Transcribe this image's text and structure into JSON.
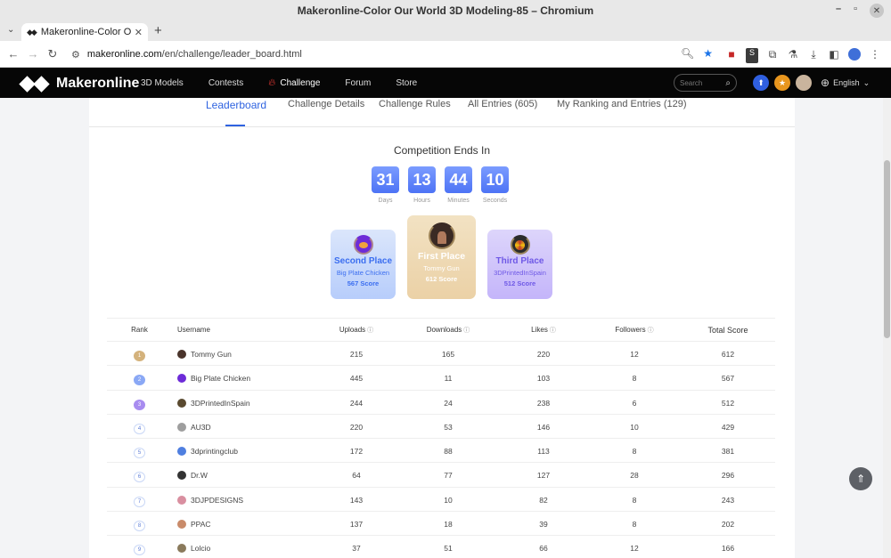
{
  "window": {
    "title": "Makeronline-Color Our World 3D Modeling-85 – Chromium"
  },
  "browser": {
    "tab_title": "Makeronline-Color Our W",
    "url_host": "makeronline.com",
    "url_path": "/en/challenge/leader_board.html"
  },
  "site": {
    "logo_text": "Makeronline",
    "nav": [
      "3D Models",
      "Contests",
      "Challenge",
      "Forum",
      "Store"
    ],
    "search_placeholder": "Search",
    "language": "English"
  },
  "subtabs": [
    "Leaderboard",
    "Challenge Details",
    "Challenge Rules",
    "All Entries (605)",
    "My Ranking and Entries (129)"
  ],
  "countdown": {
    "title": "Competition Ends In",
    "units": [
      {
        "value": "31",
        "label": "Days"
      },
      {
        "value": "13",
        "label": "Hours"
      },
      {
        "value": "44",
        "label": "Minutes"
      },
      {
        "value": "10",
        "label": "Seconds"
      }
    ]
  },
  "podium": {
    "second": {
      "place": "Second Place",
      "name": "Big Plate Chicken",
      "score": "567 Score"
    },
    "first": {
      "place": "First Place",
      "name": "Tommy Gun",
      "score": "612 Score"
    },
    "third": {
      "place": "Third Place",
      "name": "3DPrintedInSpain",
      "score": "512 Score"
    }
  },
  "table": {
    "headers": {
      "rank": "Rank",
      "username": "Username",
      "uploads": "Uploads",
      "downloads": "Downloads",
      "likes": "Likes",
      "followers": "Followers",
      "total": "Total Score"
    },
    "rows": [
      {
        "rank": "1",
        "user": "Tommy Gun",
        "uploads": "215",
        "downloads": "165",
        "likes": "220",
        "followers": "12",
        "total": "612",
        "avatar_color": "#4a342b"
      },
      {
        "rank": "2",
        "user": "Big Plate Chicken",
        "uploads": "445",
        "downloads": "11",
        "likes": "103",
        "followers": "8",
        "total": "567",
        "avatar_color": "#6d2bd8"
      },
      {
        "rank": "3",
        "user": "3DPrintedInSpain",
        "uploads": "244",
        "downloads": "24",
        "likes": "238",
        "followers": "6",
        "total": "512",
        "avatar_color": "#5a4a30"
      },
      {
        "rank": "4",
        "user": "AU3D",
        "uploads": "220",
        "downloads": "53",
        "likes": "146",
        "followers": "10",
        "total": "429",
        "avatar_color": "#9e9e9e"
      },
      {
        "rank": "5",
        "user": "3dprintingclub",
        "uploads": "172",
        "downloads": "88",
        "likes": "113",
        "followers": "8",
        "total": "381",
        "avatar_color": "#4f7fe0"
      },
      {
        "rank": "6",
        "user": "Dr.W",
        "uploads": "64",
        "downloads": "77",
        "likes": "127",
        "followers": "28",
        "total": "296",
        "avatar_color": "#333333"
      },
      {
        "rank": "7",
        "user": "3DJPDESIGNS",
        "uploads": "143",
        "downloads": "10",
        "likes": "82",
        "followers": "8",
        "total": "243",
        "avatar_color": "#d98fa0"
      },
      {
        "rank": "8",
        "user": "PPAC",
        "uploads": "137",
        "downloads": "18",
        "likes": "39",
        "followers": "8",
        "total": "202",
        "avatar_color": "#c98b6a"
      },
      {
        "rank": "9",
        "user": "Lolcio",
        "uploads": "37",
        "downloads": "51",
        "likes": "66",
        "followers": "12",
        "total": "166",
        "avatar_color": "#8a7a5c"
      }
    ]
  }
}
